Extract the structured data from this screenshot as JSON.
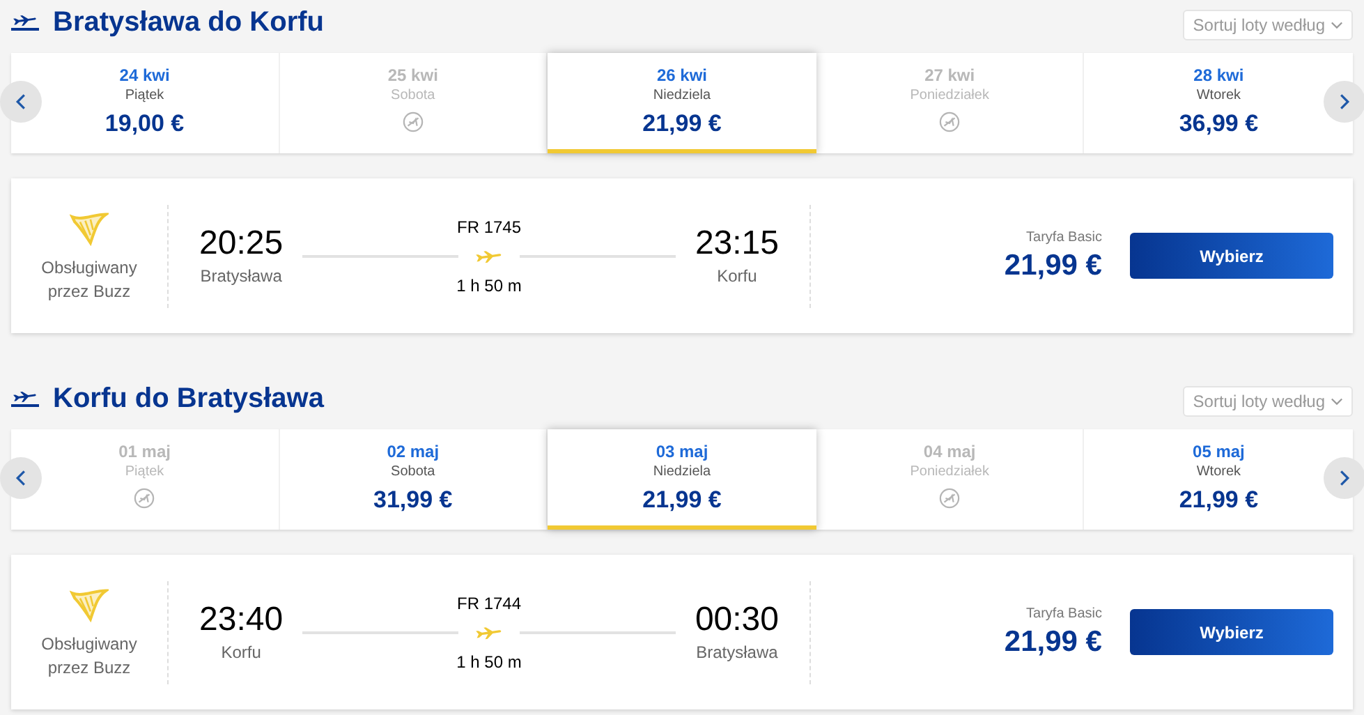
{
  "sections": [
    {
      "title": "Bratysława do Korfu",
      "sort": {
        "placeholder": "Sortuj loty według"
      },
      "days": [
        {
          "date": "24 kwi",
          "weekday": "Piątek",
          "price": "19,00 €",
          "available": true,
          "selected": false
        },
        {
          "date": "25 kwi",
          "weekday": "Sobota",
          "available": false,
          "selected": false
        },
        {
          "date": "26 kwi",
          "weekday": "Niedziela",
          "price": "21,99 €",
          "available": true,
          "selected": true
        },
        {
          "date": "27 kwi",
          "weekday": "Poniedziałek",
          "available": false,
          "selected": false
        },
        {
          "date": "28 kwi",
          "weekday": "Wtorek",
          "price": "36,99 €",
          "available": true,
          "selected": false
        }
      ],
      "flight": {
        "operator": "Obsługiwany przez Buzz",
        "departure_time": "20:25",
        "departure_city": "Bratysława",
        "flight_number": "FR 1745",
        "duration": "1 h 50 m",
        "arrival_time": "23:15",
        "arrival_city": "Korfu",
        "fare": "Taryfa Basic",
        "price": "21,99 €",
        "button": "Wybierz"
      }
    },
    {
      "title": "Korfu do Bratysława",
      "sort": {
        "placeholder": "Sortuj loty według"
      },
      "days": [
        {
          "date": "01 maj",
          "weekday": "Piątek",
          "available": false,
          "selected": false
        },
        {
          "date": "02 maj",
          "weekday": "Sobota",
          "price": "31,99 €",
          "available": true,
          "selected": false
        },
        {
          "date": "03 maj",
          "weekday": "Niedziela",
          "price": "21,99 €",
          "available": true,
          "selected": true
        },
        {
          "date": "04 maj",
          "weekday": "Poniedziałek",
          "available": false,
          "selected": false
        },
        {
          "date": "05 maj",
          "weekday": "Wtorek",
          "price": "21,99 €",
          "available": true,
          "selected": false
        }
      ],
      "flight": {
        "operator": "Obsługiwany przez Buzz",
        "departure_time": "23:40",
        "departure_city": "Korfu",
        "flight_number": "FR 1744",
        "duration": "1 h 50 m",
        "arrival_time": "00:30",
        "arrival_city": "Bratysława",
        "fare": "Taryfa Basic",
        "price": "21,99 €",
        "button": "Wybierz"
      }
    }
  ]
}
